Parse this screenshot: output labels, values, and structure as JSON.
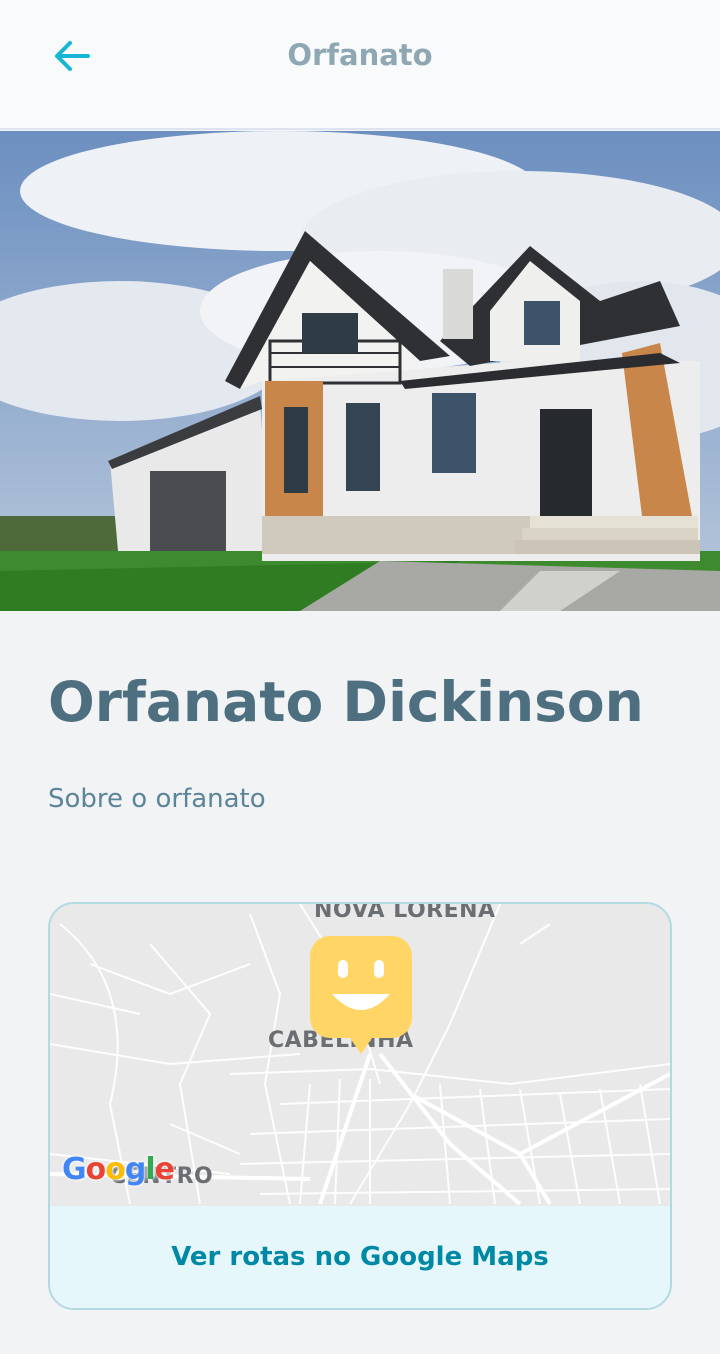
{
  "header": {
    "title": "Orfanato",
    "back_icon": "arrow-left-icon",
    "accent_color": "#15B6D6"
  },
  "orphanage": {
    "name": "Orfanato Dickinson",
    "about": "Sobre o orfanato"
  },
  "map": {
    "labels": {
      "nova_lorena": "NOVA LORENA",
      "cabelinha": "CABELINHA",
      "centro": "CENTRO"
    },
    "google_logo": "Google",
    "marker_icon": "smiley-marker-icon",
    "marker_color": "#FFD666"
  },
  "actions": {
    "directions_label": "Ver rotas no Google Maps"
  }
}
